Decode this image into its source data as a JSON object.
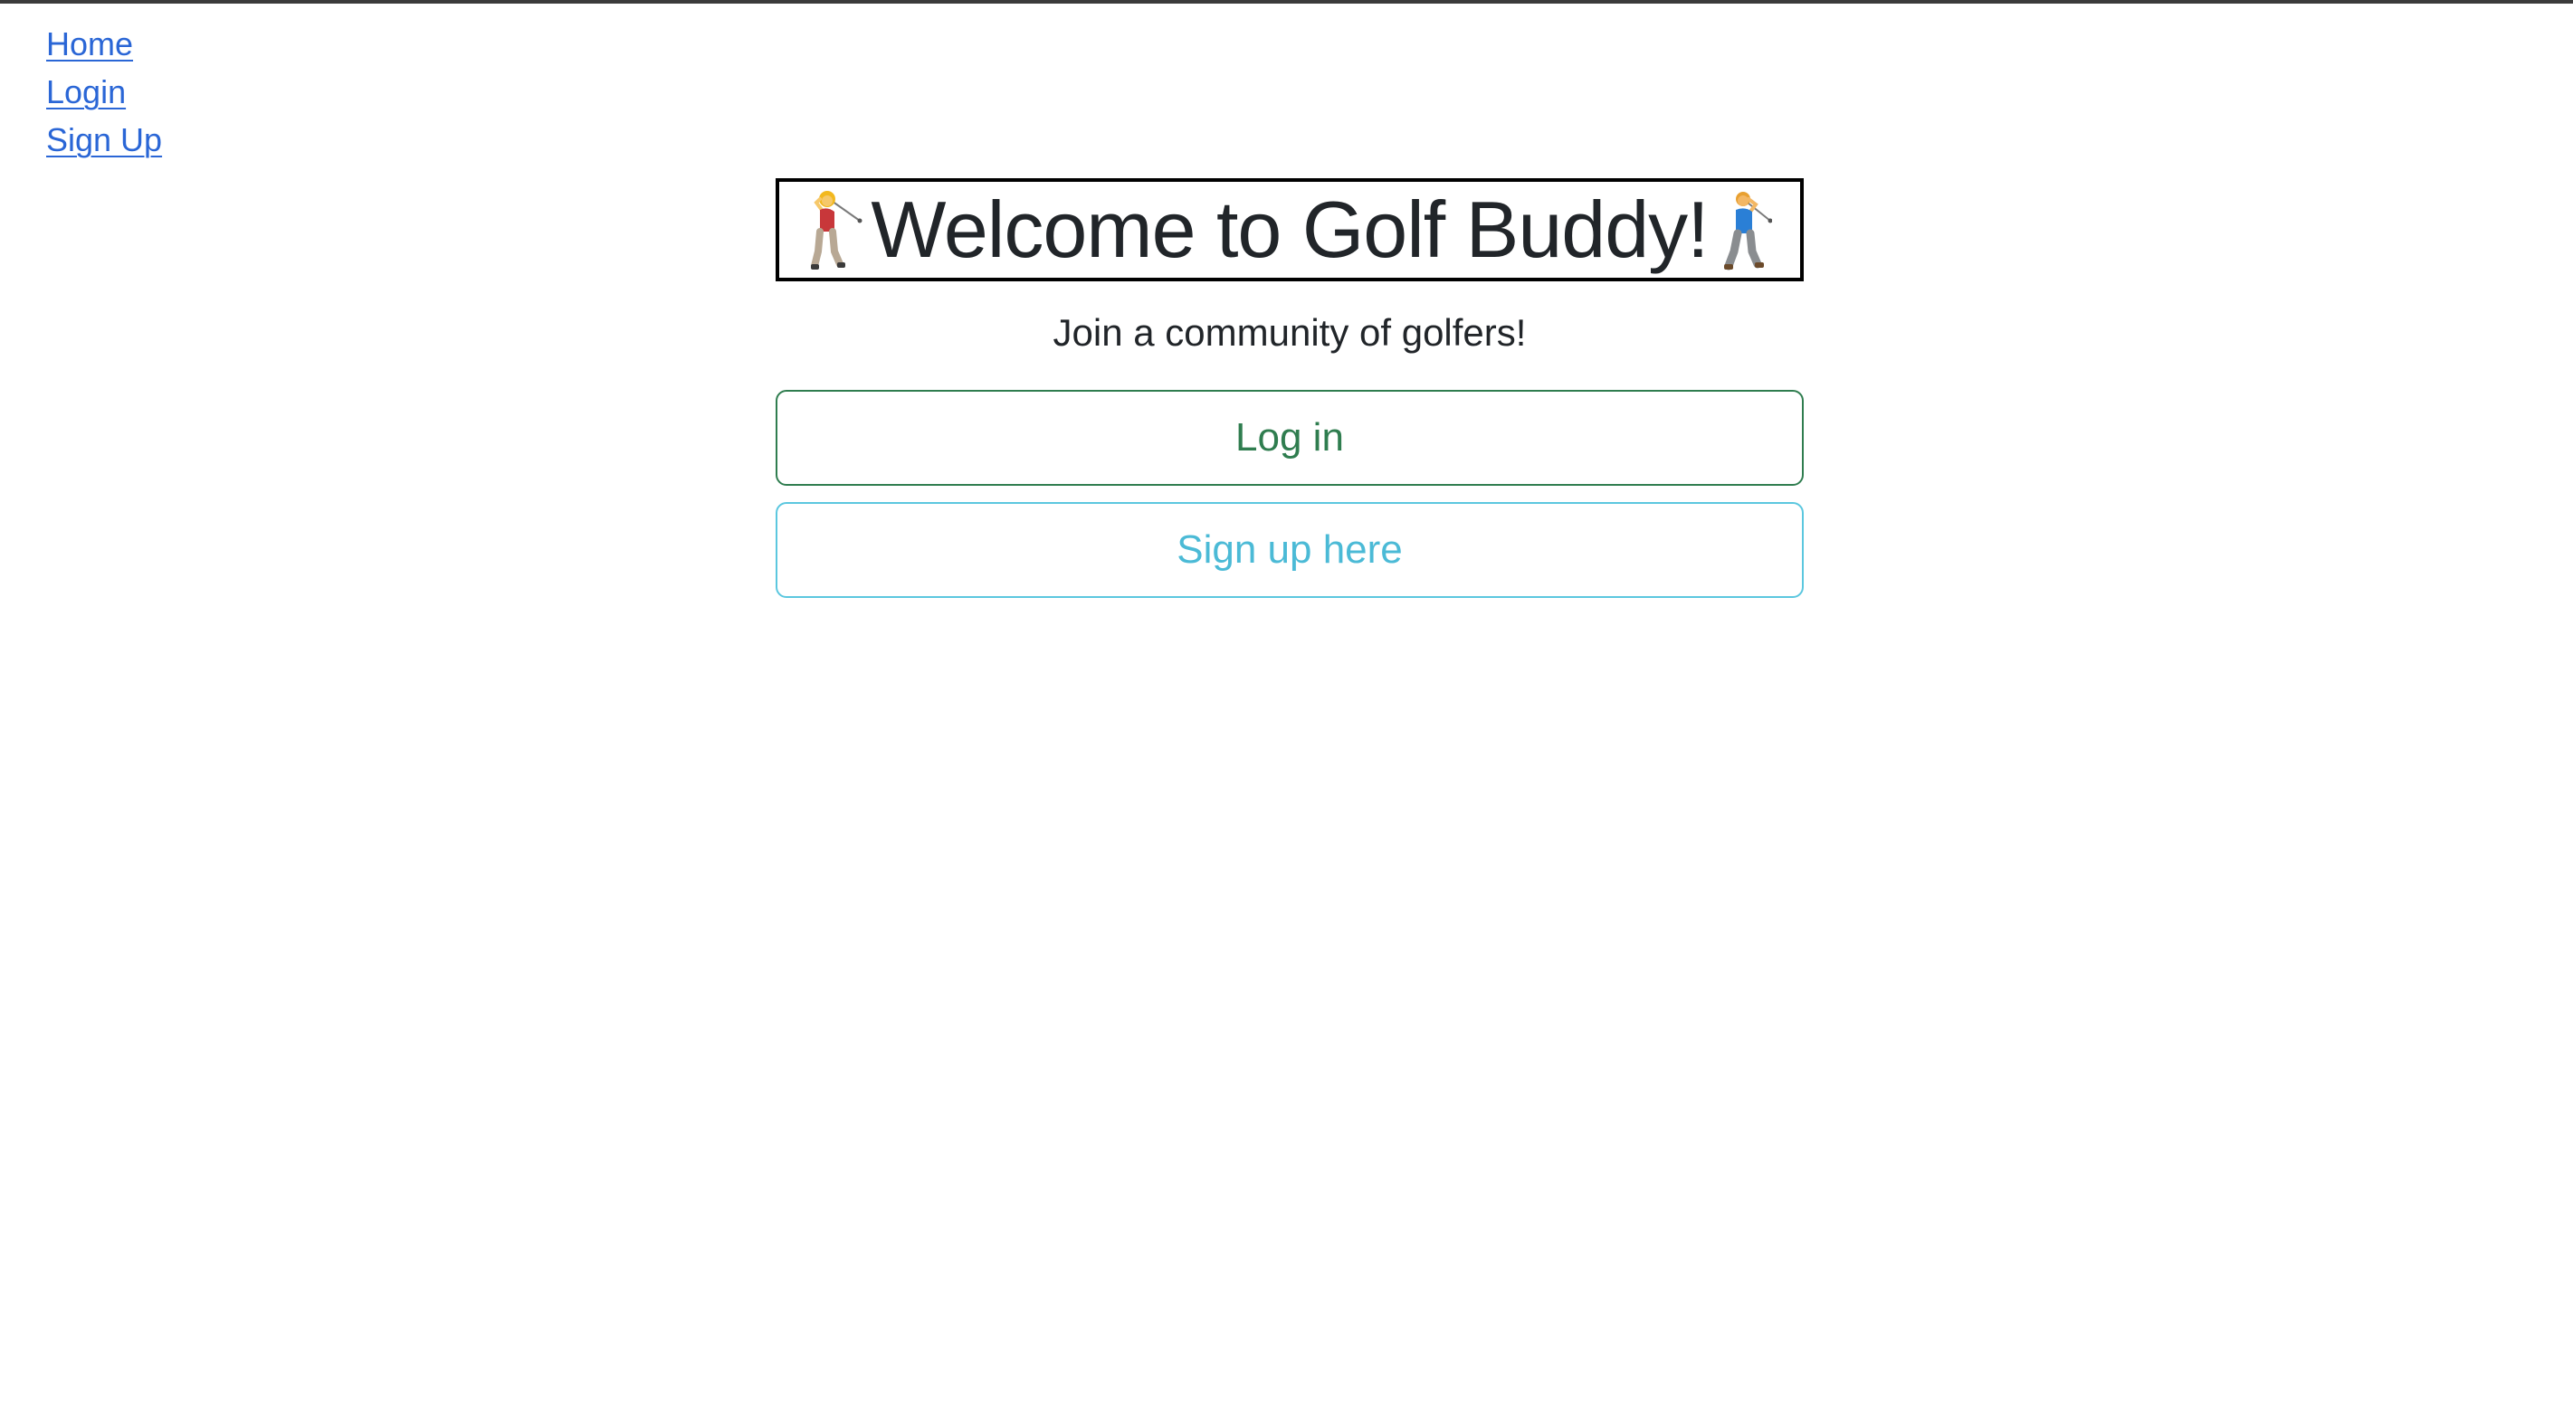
{
  "nav": {
    "items": [
      {
        "label": "Home"
      },
      {
        "label": "Login"
      },
      {
        "label": "Sign Up"
      }
    ]
  },
  "hero": {
    "title": "Welcome to Golf Buddy!",
    "left_icon": "woman-golfing-icon",
    "right_icon": "man-golfing-icon",
    "subtitle": "Join a community of golfers!"
  },
  "buttons": {
    "login_label": "Log in",
    "signup_label": "Sign up here"
  },
  "colors": {
    "link": "#2a66d6",
    "login_accent": "#2f7d4f",
    "signup_accent": "#4bbad6",
    "text": "#212529",
    "title_border": "#000000"
  }
}
